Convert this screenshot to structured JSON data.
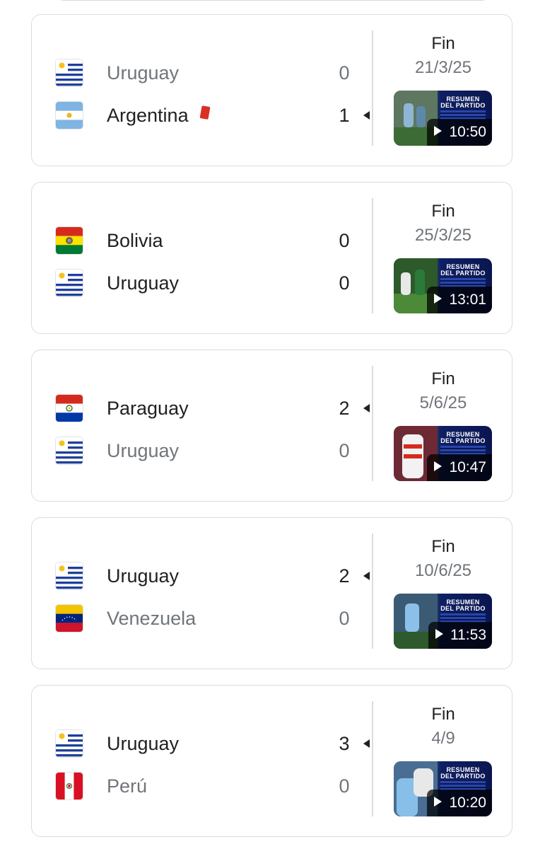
{
  "colors": {
    "border": "#dadce0",
    "text_primary": "#202124",
    "text_secondary": "#70757a",
    "red_card": "#d93025",
    "thumbnail_blue": "#0e1f63"
  },
  "thumbnail_banner": [
    "RESUMEN",
    "DEL PARTIDO"
  ],
  "matches": [
    {
      "status": "Fin",
      "date": "21/3/25",
      "duration": "10:50",
      "home": {
        "team": "Uruguay",
        "flag": "uruguay-flag-icon",
        "score": "0",
        "winner": false,
        "red_card": false
      },
      "away": {
        "team": "Argentina",
        "flag": "argentina-flag-icon",
        "score": "1",
        "winner": true,
        "red_card": true
      }
    },
    {
      "status": "Fin",
      "date": "25/3/25",
      "duration": "13:01",
      "home": {
        "team": "Bolivia",
        "flag": "bolivia-flag-icon",
        "score": "0",
        "winner": false,
        "red_card": false,
        "draw": true
      },
      "away": {
        "team": "Uruguay",
        "flag": "uruguay-flag-icon",
        "score": "0",
        "winner": false,
        "red_card": false,
        "draw": true
      }
    },
    {
      "status": "Fin",
      "date": "5/6/25",
      "duration": "10:47",
      "home": {
        "team": "Paraguay",
        "flag": "paraguay-flag-icon",
        "score": "2",
        "winner": true,
        "red_card": false
      },
      "away": {
        "team": "Uruguay",
        "flag": "uruguay-flag-icon",
        "score": "0",
        "winner": false,
        "red_card": false
      }
    },
    {
      "status": "Fin",
      "date": "10/6/25",
      "duration": "11:53",
      "home": {
        "team": "Uruguay",
        "flag": "uruguay-flag-icon",
        "score": "2",
        "winner": true,
        "red_card": false
      },
      "away": {
        "team": "Venezuela",
        "flag": "venezuela-flag-icon",
        "score": "0",
        "winner": false,
        "red_card": false
      }
    },
    {
      "status": "Fin",
      "date": "4/9",
      "duration": "10:20",
      "home": {
        "team": "Uruguay",
        "flag": "uruguay-flag-icon",
        "score": "3",
        "winner": true,
        "red_card": false
      },
      "away": {
        "team": "Perú",
        "flag": "peru-flag-icon",
        "score": "0",
        "winner": false,
        "red_card": false
      }
    }
  ]
}
